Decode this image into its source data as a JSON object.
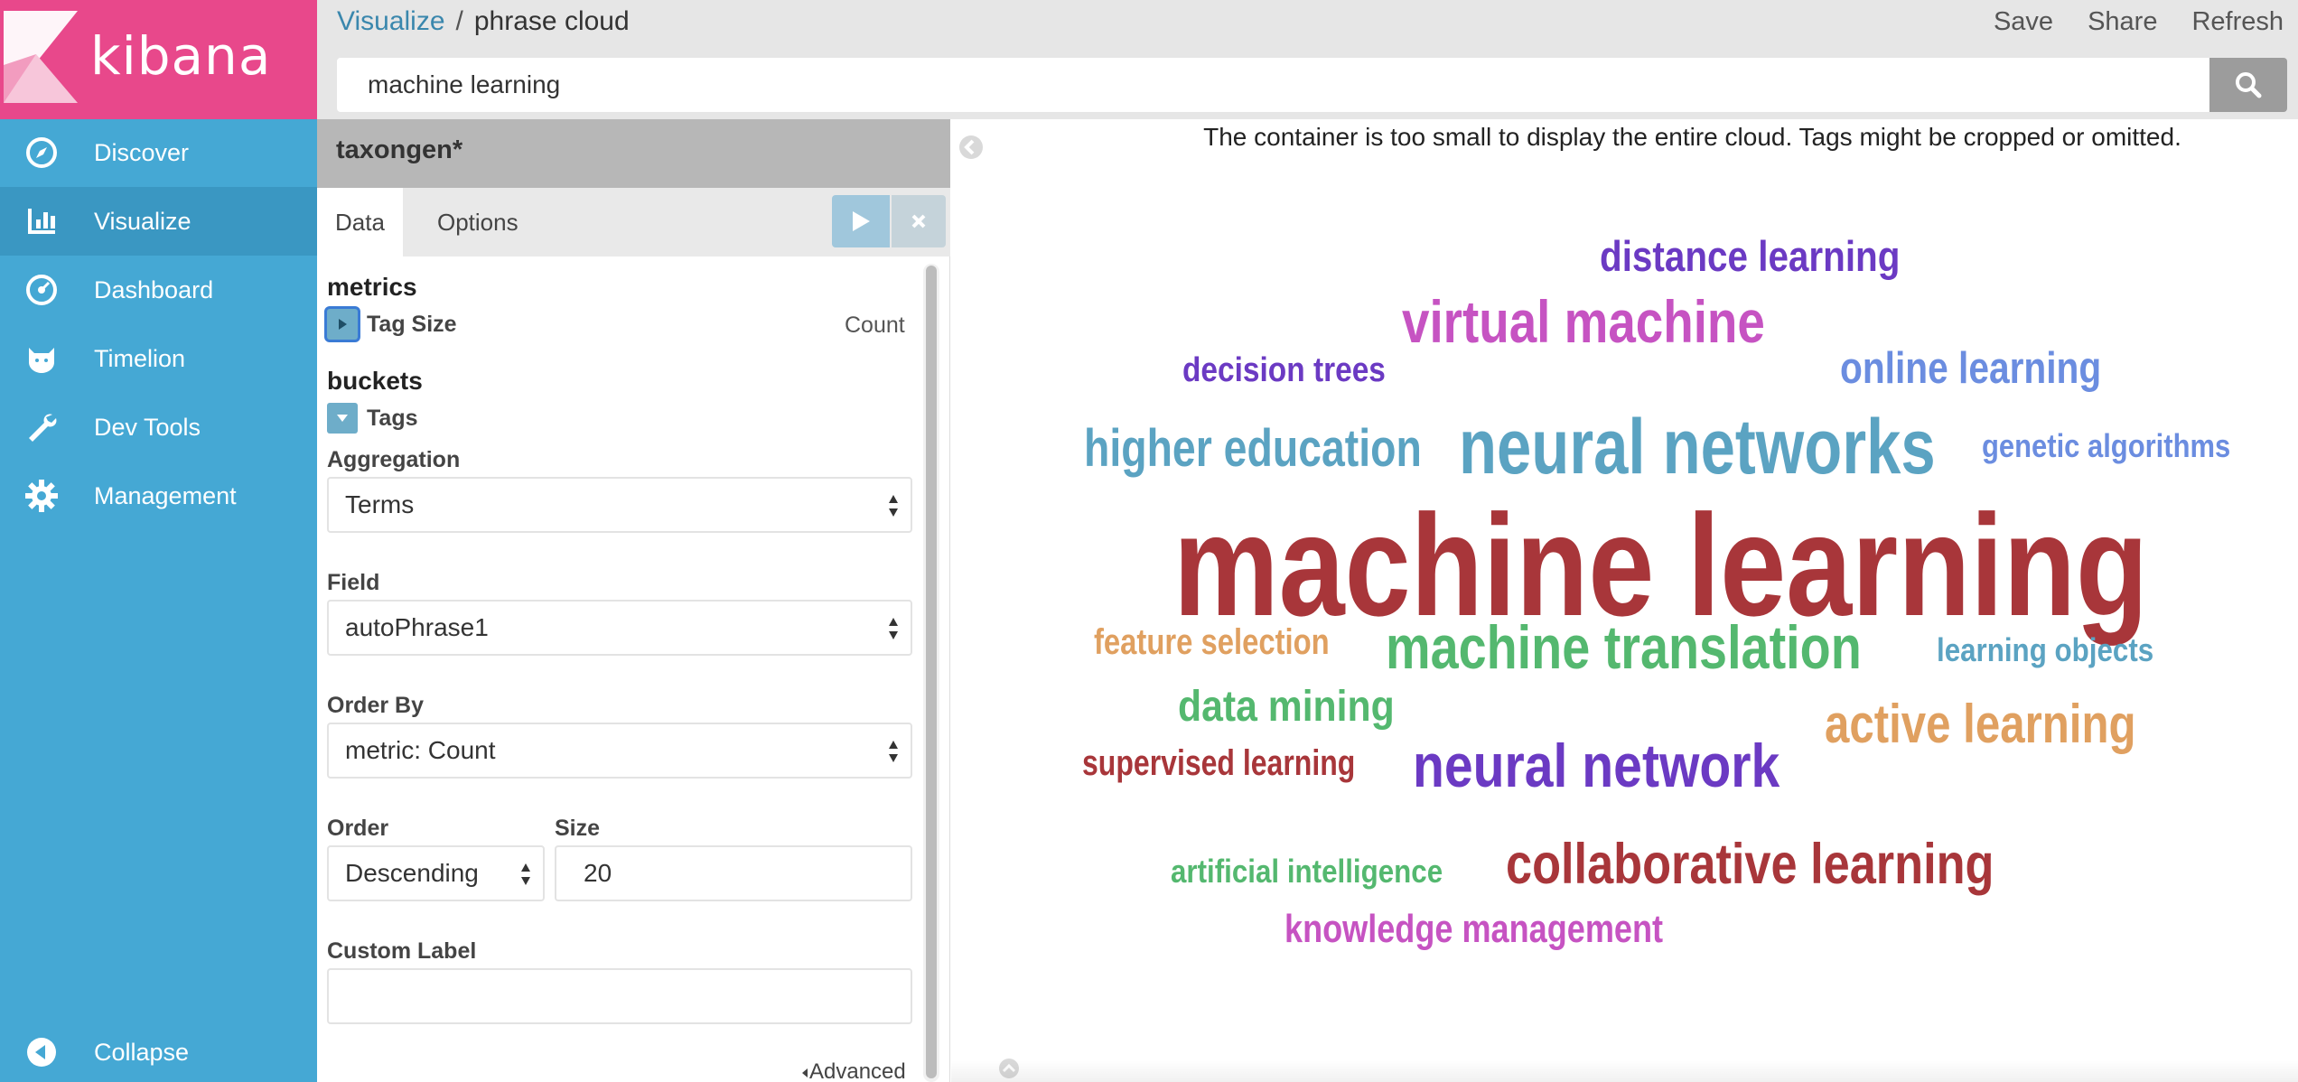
{
  "app": {
    "logo_text": "kibana",
    "brand_color": "#e8488b",
    "sidebar_color": "#45a8d4"
  },
  "sidebar": {
    "items": [
      {
        "label": "Discover",
        "icon": "compass-icon"
      },
      {
        "label": "Visualize",
        "icon": "bar-chart-icon",
        "active": true
      },
      {
        "label": "Dashboard",
        "icon": "dashboard-icon"
      },
      {
        "label": "Timelion",
        "icon": "timelion-icon"
      },
      {
        "label": "Dev Tools",
        "icon": "wrench-icon"
      },
      {
        "label": "Management",
        "icon": "gear-icon"
      }
    ],
    "collapse_label": "Collapse"
  },
  "header": {
    "breadcrumb_link": "Visualize",
    "breadcrumb_separator": "/",
    "breadcrumb_current": "phrase cloud",
    "actions": {
      "save": "Save",
      "share": "Share",
      "refresh": "Refresh"
    },
    "search_value": "machine learning"
  },
  "editor": {
    "title": "taxongen*",
    "tabs": {
      "data": "Data",
      "options": "Options"
    },
    "metrics_title": "metrics",
    "tag_size_label": "Tag Size",
    "tag_size_agg": "Count",
    "buckets_title": "buckets",
    "tags_label": "Tags",
    "aggregation_label": "Aggregation",
    "aggregation_value": "Terms",
    "field_label": "Field",
    "field_value": "autoPhrase1",
    "order_by_label": "Order By",
    "order_by_value": "metric: Count",
    "order_label": "Order",
    "order_value": "Descending",
    "size_label": "Size",
    "size_value": "20",
    "custom_label_label": "Custom Label",
    "custom_label_value": "",
    "advanced_label": "Advanced"
  },
  "visualization": {
    "warning": "The container is too small to display the entire cloud. Tags might be cropped or omitted.",
    "words": [
      {
        "text": "distance learning",
        "color": "#6b3ac3"
      },
      {
        "text": "virtual machine",
        "color": "#c653c2"
      },
      {
        "text": "decision trees",
        "color": "#6b3ac3"
      },
      {
        "text": "online learning",
        "color": "#6b8de0"
      },
      {
        "text": "higher education",
        "color": "#5ba3c2"
      },
      {
        "text": "neural networks",
        "color": "#5ba3c2"
      },
      {
        "text": "genetic algorithms",
        "color": "#6b8de0"
      },
      {
        "text": "machine learning",
        "color": "#a8363a"
      },
      {
        "text": "feature selection",
        "color": "#e0a060"
      },
      {
        "text": "machine translation",
        "color": "#54b86f"
      },
      {
        "text": "learning objects",
        "color": "#5ba3c2"
      },
      {
        "text": "data mining",
        "color": "#54b86f"
      },
      {
        "text": "active learning",
        "color": "#e0a060"
      },
      {
        "text": "supervised learning",
        "color": "#a8363a"
      },
      {
        "text": "neural network",
        "color": "#6b3ac3"
      },
      {
        "text": "artificial intelligence",
        "color": "#54b86f"
      },
      {
        "text": "collaborative learning",
        "color": "#a8363a"
      },
      {
        "text": "knowledge management",
        "color": "#c653c2"
      }
    ]
  }
}
